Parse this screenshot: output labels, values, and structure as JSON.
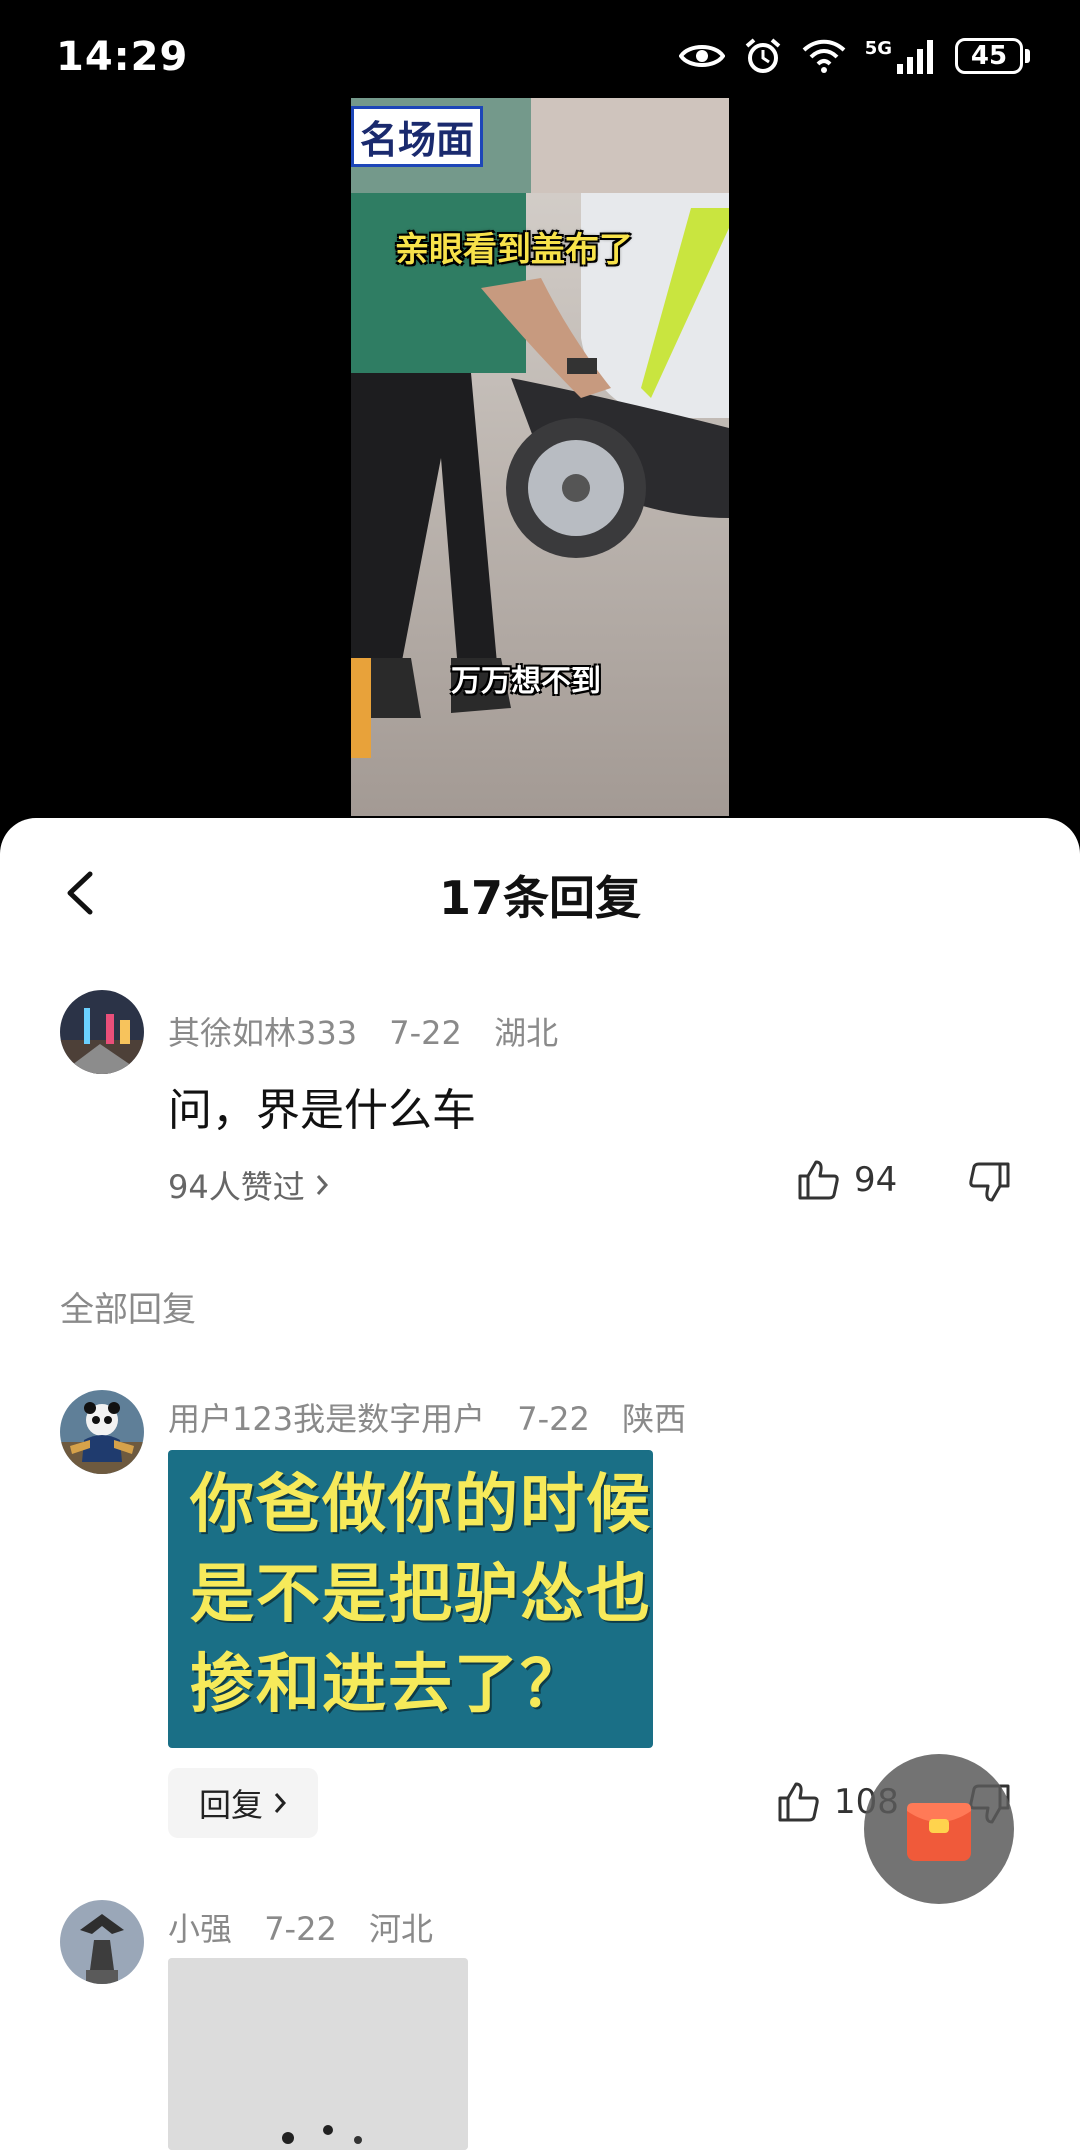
{
  "status_bar": {
    "time": "14:29",
    "network": "5G",
    "battery": "45"
  },
  "video": {
    "caption_top": "亲眼看到盖布了",
    "caption_middle": "万万想不到",
    "caption_bottom": "名场面"
  },
  "sheet": {
    "title": "17条回复",
    "main_comment": {
      "username": "其徐如林333",
      "date": "7-22",
      "location": "湖北",
      "text": "问，界是什么车",
      "likes_link": "94人赞过",
      "like_count": "94"
    },
    "section_label": "全部回复",
    "replies": [
      {
        "username": "用户123我是数字用户",
        "date": "7-22",
        "location": "陕西",
        "image_text": "你爸做你的时候\n是不是把驴怂也\n掺和进去了？",
        "reply_label": "回复",
        "like_count": "108"
      },
      {
        "username": "小强",
        "date": "7-22",
        "location": "河北"
      }
    ]
  },
  "colors": {
    "image_bg": "#1a6f86",
    "image_text": "#f6ea5a",
    "red_packet": "#f05a3a"
  }
}
